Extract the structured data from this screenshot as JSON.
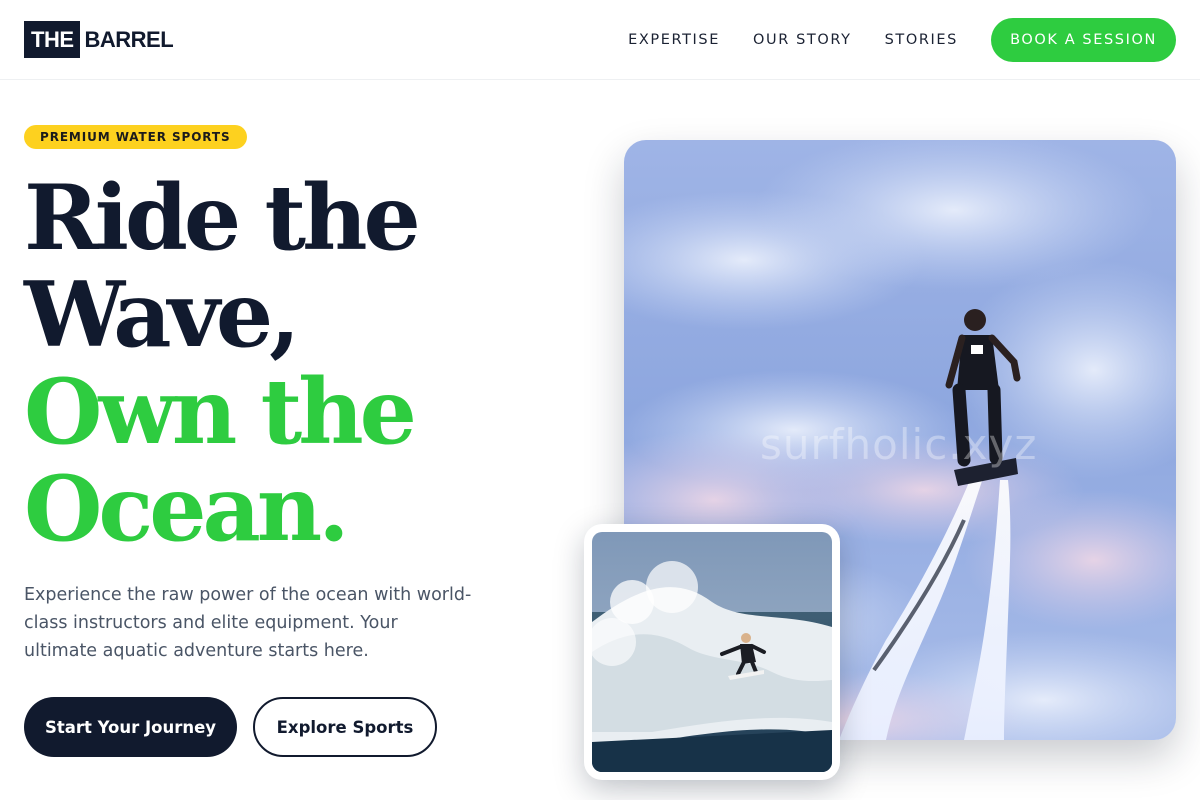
{
  "brand": {
    "logo_box": "THE",
    "logo_text": "BARREL"
  },
  "nav": {
    "links": [
      "EXPERTISE",
      "OUR STORY",
      "STORIES"
    ],
    "cta": "BOOK A SESSION"
  },
  "hero": {
    "badge": "PREMIUM WATER SPORTS",
    "headline": {
      "line1": "Ride the",
      "line2": "Wave,",
      "line3": "Own the",
      "line4": "Ocean."
    },
    "lead": "Experience the raw power of the ocean with world-class instructors and elite equipment. Your ultimate aquatic adventure starts here.",
    "primary_button": "Start Your Journey",
    "secondary_button": "Explore Sports"
  },
  "images": {
    "main_watermark": "surfholic.xyz",
    "main_alt_icon": "flyboard-rider-photo",
    "inset_alt_icon": "surfer-wave-photo"
  },
  "colors": {
    "navy": "#111a2e",
    "accent_green": "#2ecc40",
    "badge_yellow": "#fdd11f",
    "body_text": "#4a5566"
  }
}
